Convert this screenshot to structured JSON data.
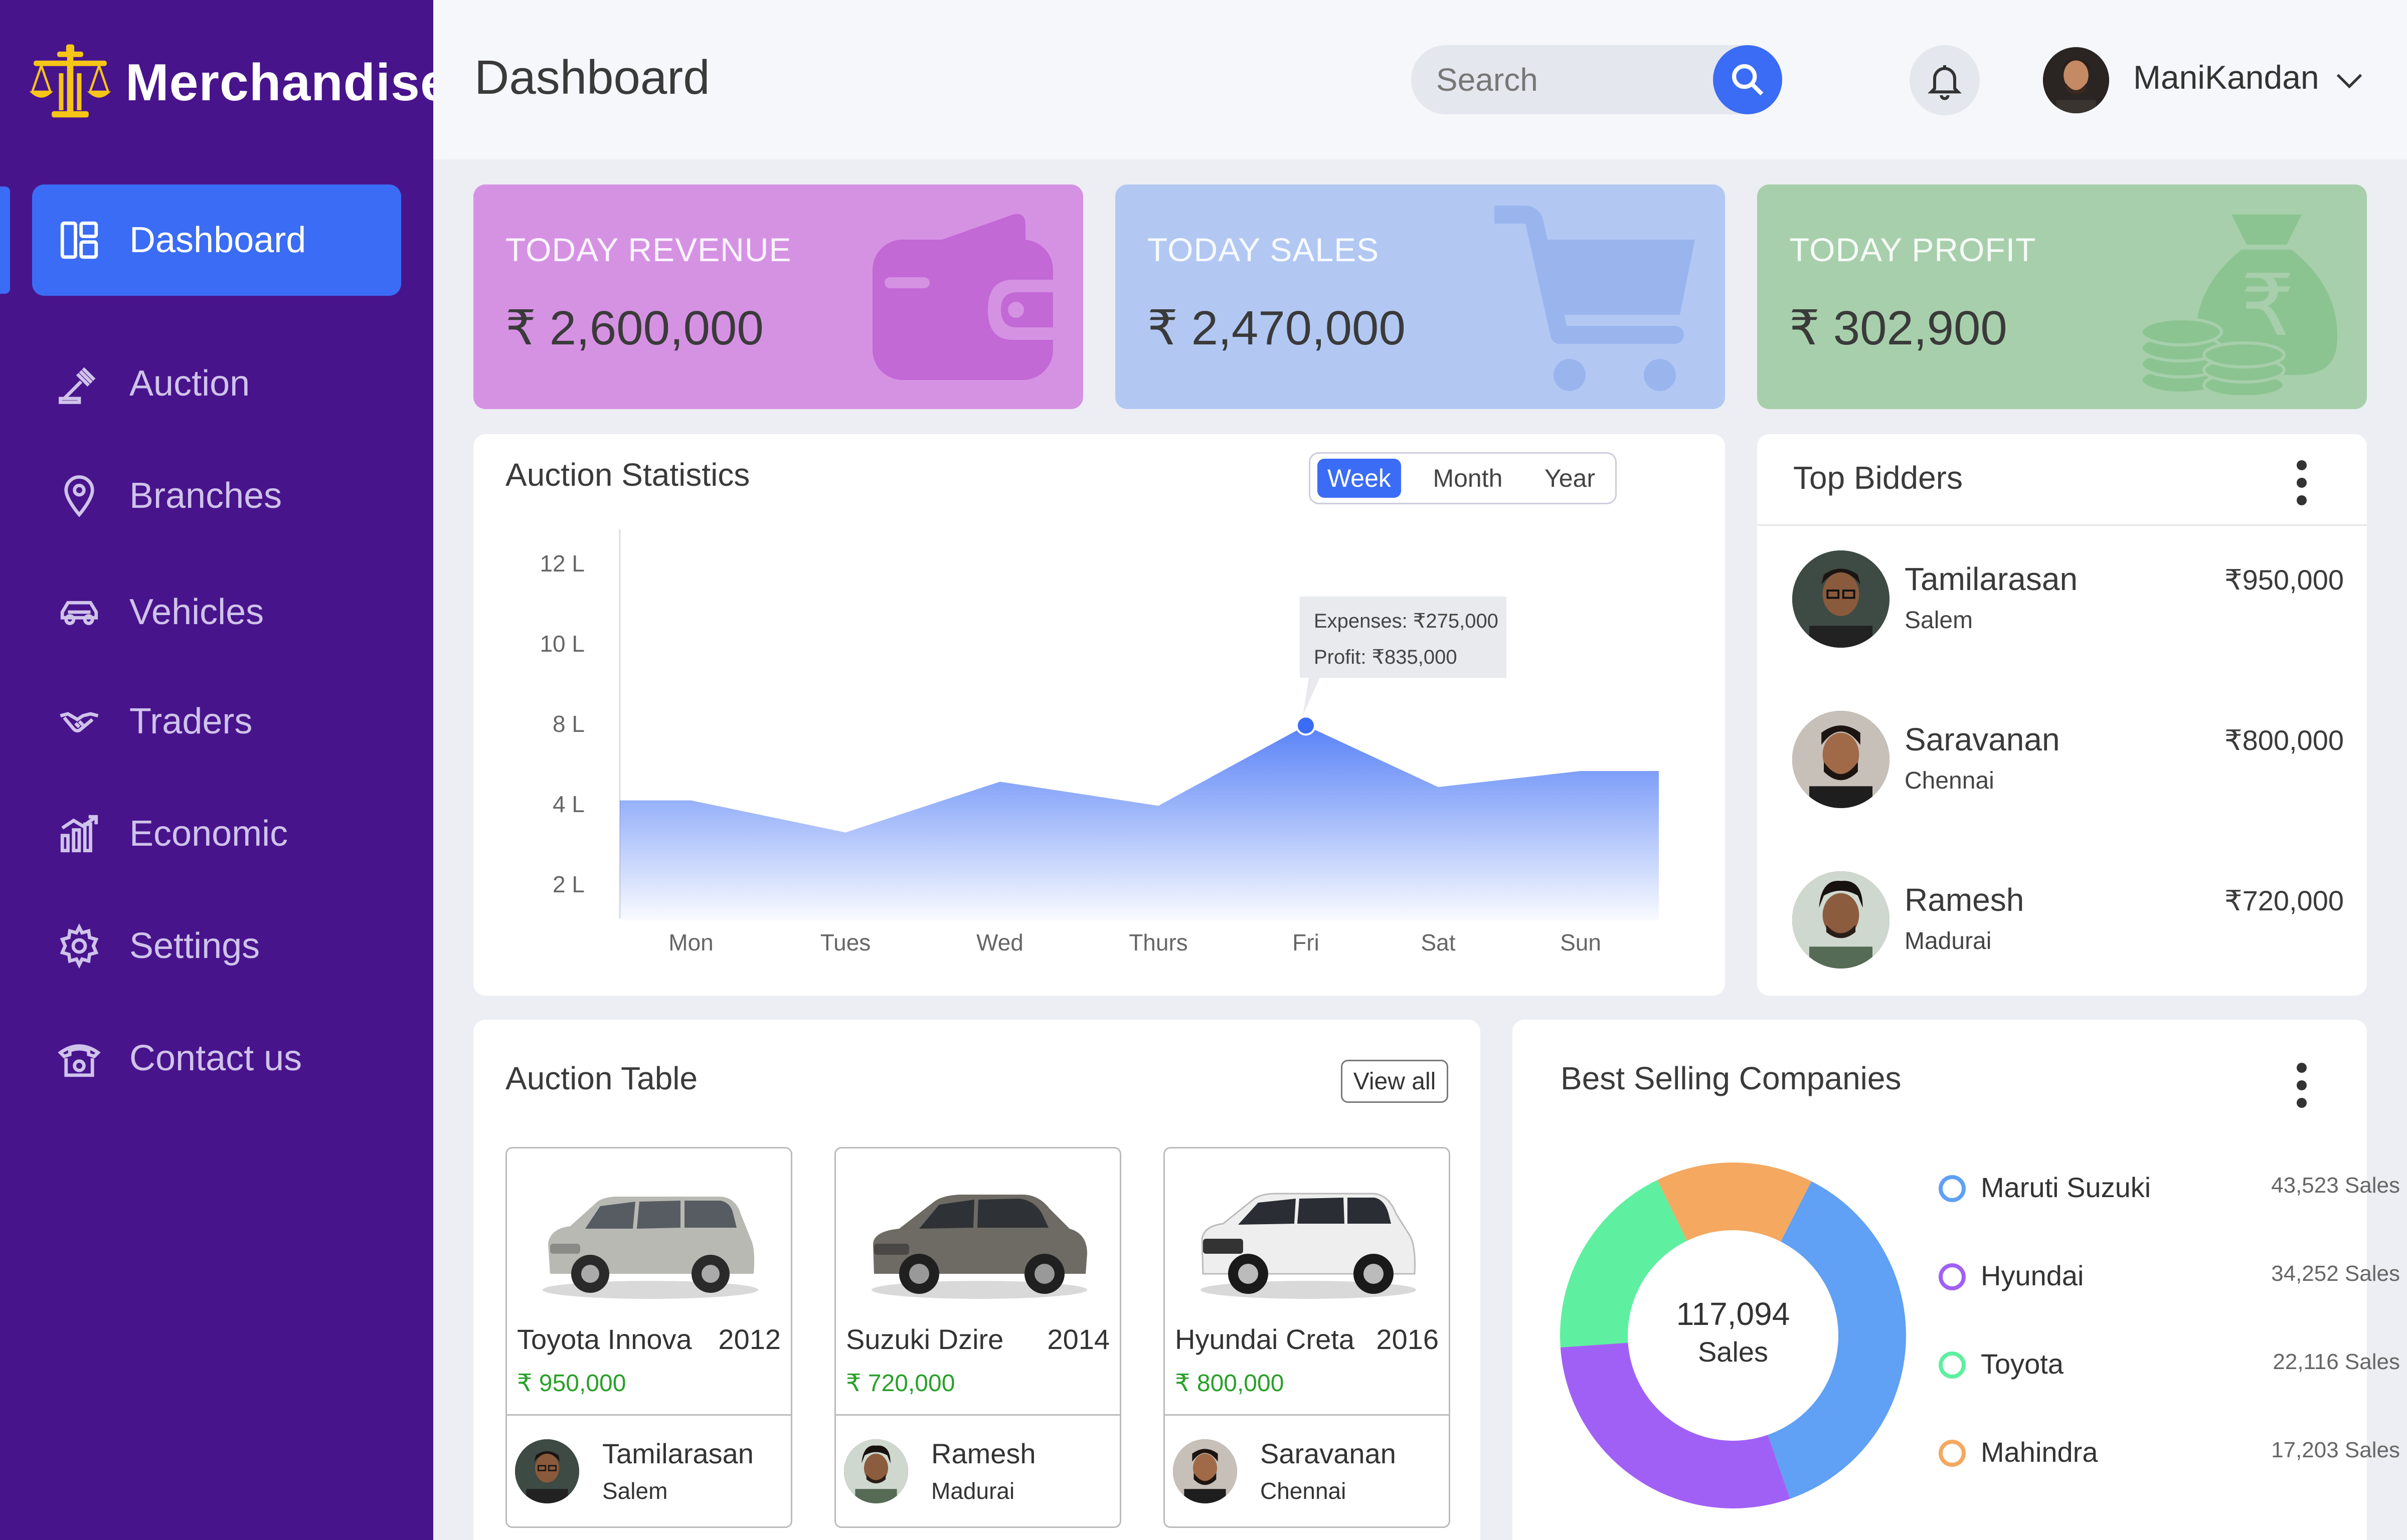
{
  "brand": {
    "name": "Merchandise"
  },
  "sidebar": {
    "items": [
      {
        "label": "Dashboard",
        "icon": "dashboard-icon"
      },
      {
        "label": "Auction",
        "icon": "gavel-icon"
      },
      {
        "label": "Branches",
        "icon": "location-pin-icon"
      },
      {
        "label": "Vehicles",
        "icon": "car-icon"
      },
      {
        "label": "Traders",
        "icon": "handshake-icon"
      },
      {
        "label": "Economic",
        "icon": "growth-chart-icon"
      },
      {
        "label": "Settings",
        "icon": "gear-icon"
      },
      {
        "label": "Contact us",
        "icon": "telephone-icon"
      }
    ]
  },
  "header": {
    "title": "Dashboard",
    "search_placeholder": "Search",
    "user_name": "ManiKandan"
  },
  "stats": [
    {
      "label": "TODAY REVENUE",
      "value": "₹ 2,600,000",
      "color": "#d592e3",
      "icon": "wallet-icon"
    },
    {
      "label": "TODAY SALES",
      "value": "₹ 2,470,000",
      "color": "#b2c8f3",
      "icon": "cart-icon"
    },
    {
      "label": "TODAY PROFIT",
      "value": "₹ 302,900",
      "color": "#a7cfab",
      "icon": "money-bag-icon"
    }
  ],
  "auction_stats": {
    "title": "Auction Statistics",
    "periods": [
      "Week",
      "Month",
      "Year"
    ],
    "selected_period": "Week",
    "tooltip": {
      "expenses": "Expenses: ₹275,000",
      "profit": "Profit: ₹835,000"
    }
  },
  "chart_data": {
    "type": "area",
    "categories": [
      "Mon",
      "Tues",
      "Wed",
      "Thurs",
      "Fri",
      "Sat",
      "Sun"
    ],
    "y_tick_labels": [
      "12 L",
      "10 L",
      "8 L",
      "4 L",
      "2 L"
    ],
    "points": [
      {
        "x": "Mon",
        "y": 5.1
      },
      {
        "x": "Mon",
        "y": 5.1
      },
      {
        "x": "Tues",
        "y": 3.9
      },
      {
        "x": "Wed",
        "y": 5.8
      },
      {
        "x": "Thurs",
        "y": 4.9
      },
      {
        "x": "Fri",
        "y": 7.9
      },
      {
        "x": "Sat",
        "y": 5.6
      },
      {
        "x": "Sun",
        "y": 6.2
      }
    ],
    "highlight": {
      "x": "Fri",
      "y": 7.9
    },
    "color": "#3b6cf5"
  },
  "top_bidders": {
    "title": "Top Bidders",
    "items": [
      {
        "name": "Tamilarasan",
        "city": "Salem",
        "amount": "₹950,000"
      },
      {
        "name": "Saravanan",
        "city": "Chennai",
        "amount": "₹800,000"
      },
      {
        "name": "Ramesh",
        "city": "Madurai",
        "amount": "₹720,000"
      }
    ]
  },
  "auction_table": {
    "title": "Auction Table",
    "view_all": "View all",
    "cards": [
      {
        "car": "Toyota Innova",
        "year": "2012",
        "price": "₹ 950,000",
        "bidder": "Tamilarasan",
        "city": "Salem",
        "car_color": "#b9b9b4"
      },
      {
        "car": "Suzuki Dzire",
        "year": "2014",
        "price": "₹ 720,000",
        "bidder": "Ramesh",
        "city": "Madurai",
        "car_color": "#6e6a64"
      },
      {
        "car": "Hyundai Creta",
        "year": "2016",
        "price": "₹ 800,000",
        "bidder": "Saravanan",
        "city": "Chennai",
        "car_color": "#eeeeee"
      }
    ]
  },
  "best_selling": {
    "title": "Best Selling Companies",
    "total_value": "117,094",
    "total_label": "Sales",
    "companies": [
      {
        "name": "Maruti Suzuki",
        "sales": "43,523 Sales",
        "value": 43523,
        "color": "#60a0f5"
      },
      {
        "name": "Hyundai",
        "sales": "34,252 Sales",
        "value": 34252,
        "color": "#a160f5"
      },
      {
        "name": "Toyota",
        "sales": "22,116 Sales",
        "value": 22116,
        "color": "#5ef0a0"
      },
      {
        "name": "Mahindra",
        "sales": "17,203 Sales",
        "value": 17203,
        "color": "#f5a860"
      }
    ]
  }
}
